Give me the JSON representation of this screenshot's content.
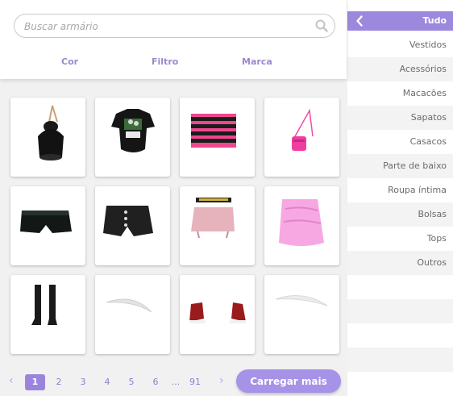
{
  "search": {
    "placeholder": "Buscar armário",
    "value": ""
  },
  "filter_tabs": [
    {
      "label": "Cor"
    },
    {
      "label": "Filtro"
    },
    {
      "label": "Marca"
    }
  ],
  "items": [
    {
      "name": "black-bucket-bag"
    },
    {
      "name": "black-graphic-tshirt"
    },
    {
      "name": "pink-black-striped-top"
    },
    {
      "name": "pink-mini-bag"
    },
    {
      "name": "black-leather-shorts"
    },
    {
      "name": "black-denim-shorts"
    },
    {
      "name": "pink-belted-mini-skirt"
    },
    {
      "name": "pink-mini-skirt"
    },
    {
      "name": "black-thigh-high-stockings"
    },
    {
      "name": "white-item"
    },
    {
      "name": "red-high-top-sneakers"
    },
    {
      "name": "white-item-2"
    }
  ],
  "pagination": {
    "prev_icon": "chevron-left-icon",
    "pages": [
      "1",
      "2",
      "3",
      "4",
      "5",
      "6"
    ],
    "ellipsis": "...",
    "last_page": "91",
    "current": "1",
    "next_icon": "chevron-right-icon"
  },
  "load_more_label": "Carregar mais",
  "sidebar": {
    "header_label": "Tudo",
    "back_icon": "chevron-left-icon",
    "categories": [
      {
        "label": "Vestidos"
      },
      {
        "label": "Acessórios"
      },
      {
        "label": "Macacões"
      },
      {
        "label": "Sapatos"
      },
      {
        "label": "Casacos"
      },
      {
        "label": "Parte de baixo"
      },
      {
        "label": "Roupa íntima"
      },
      {
        "label": "Bolsas"
      },
      {
        "label": "Tops"
      },
      {
        "label": "Outros"
      }
    ]
  },
  "colors": {
    "accent": "#9c88dc",
    "accent_light": "#a693e8",
    "tab_text": "#9b88d0",
    "page_bg": "#f1f1f1"
  }
}
